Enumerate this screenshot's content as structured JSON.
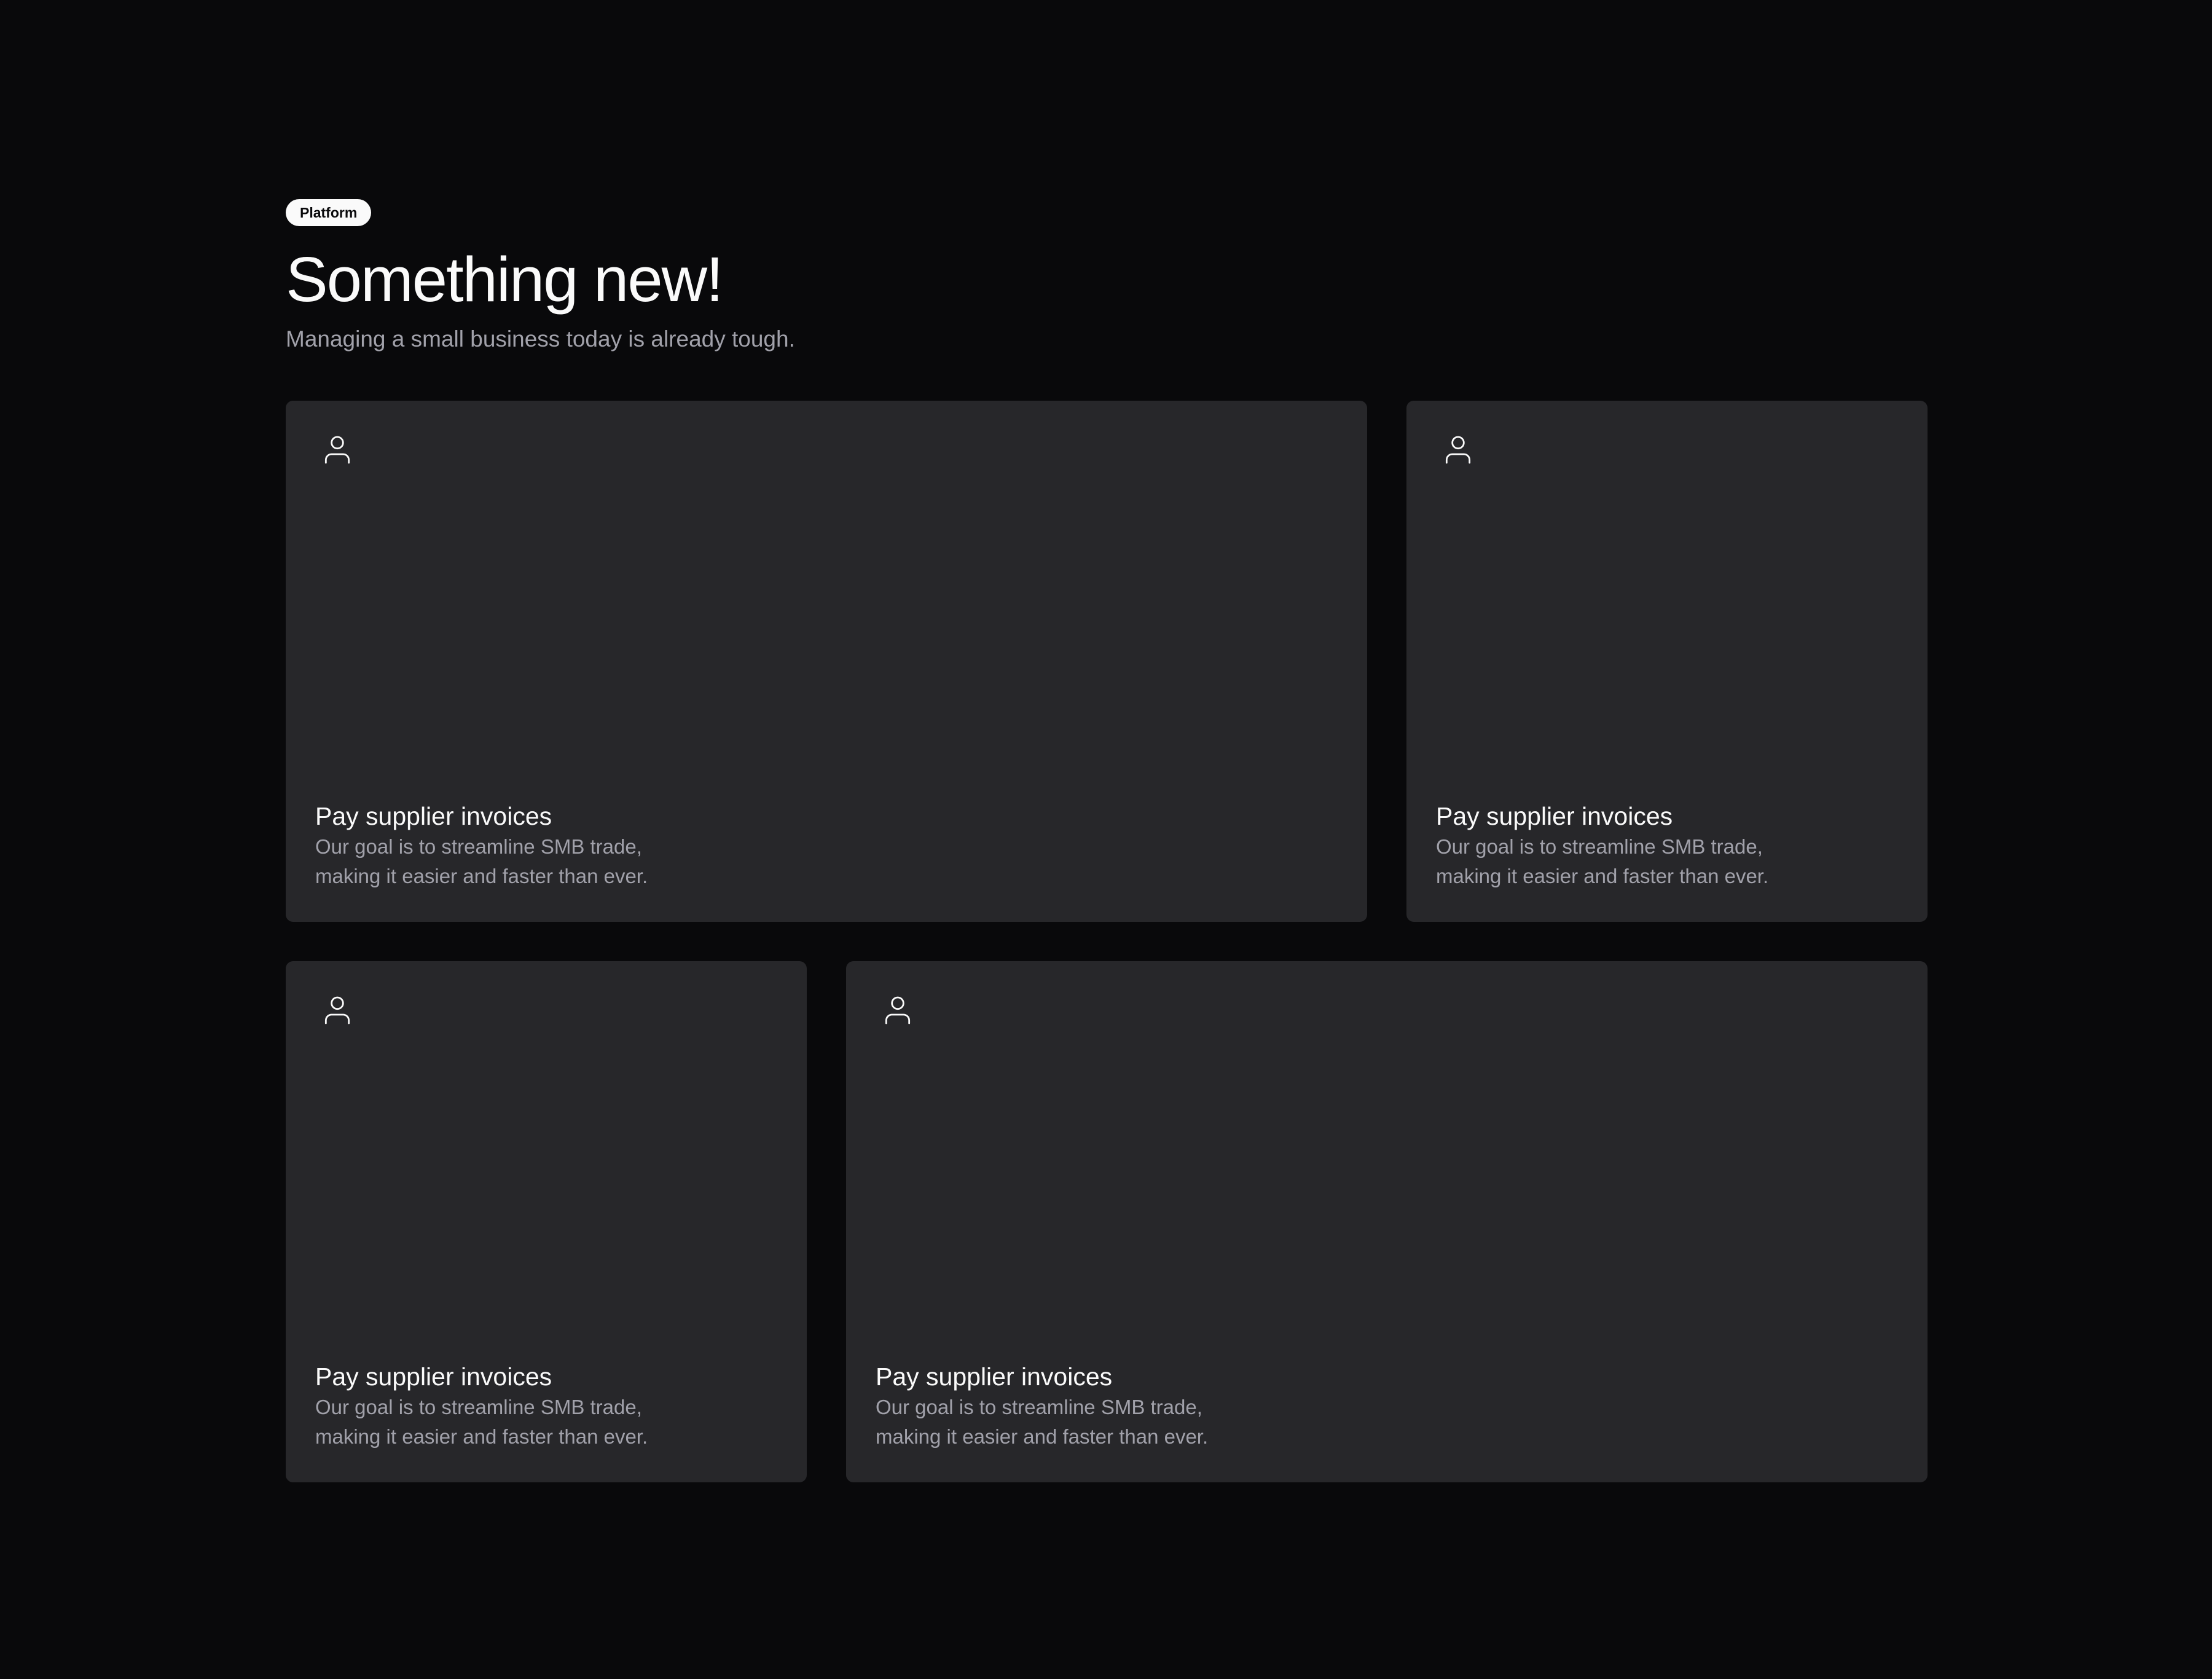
{
  "header": {
    "badge": "Platform",
    "title": "Something new!",
    "subtitle": "Managing a small business today is already tough."
  },
  "cards": [
    {
      "icon": "user-icon",
      "title": "Pay supplier invoices",
      "description": "Our goal is to streamline SMB trade,\nmaking it easier and faster than ever."
    },
    {
      "icon": "user-icon",
      "title": "Pay supplier invoices",
      "description": "Our goal is to streamline SMB trade,\nmaking it easier and faster than ever."
    },
    {
      "icon": "user-icon",
      "title": "Pay supplier invoices",
      "description": "Our goal is to streamline SMB trade,\nmaking it easier and faster than ever."
    },
    {
      "icon": "user-icon",
      "title": "Pay supplier invoices",
      "description": "Our goal is to streamline SMB trade,\nmaking it easier and faster than ever."
    }
  ],
  "colors": {
    "background": "#09090b",
    "card": "#27272a",
    "text": "#fafafa",
    "muted": "#a1a1aa"
  }
}
